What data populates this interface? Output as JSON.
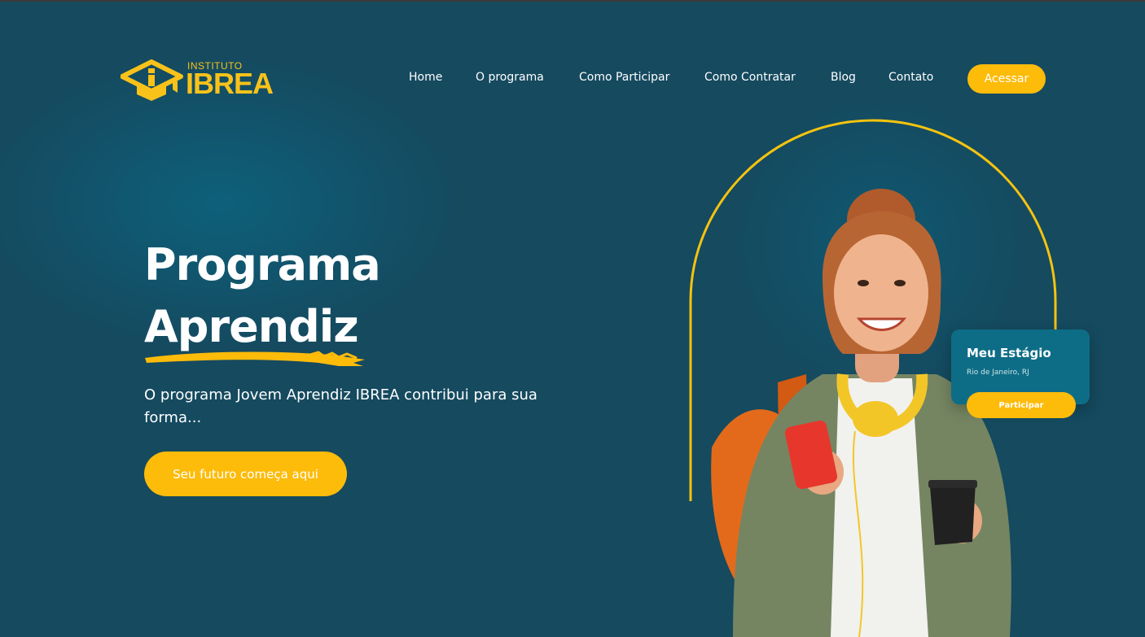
{
  "logo": {
    "small": "INSTITUTO",
    "big": "IBREA"
  },
  "nav": [
    "Home",
    "O programa",
    "Como Participar",
    "Como Contratar",
    "Blog",
    "Contato"
  ],
  "access_button": "Acessar",
  "hero": {
    "title_line1": "Programa",
    "title_line2": "Aprendiz",
    "description": "O programa Jovem Aprendiz IBREA contribui para sua forma...",
    "cta": "Seu futuro começa aqui"
  },
  "card": {
    "title": "Meu Estágio",
    "location": "Rio de Janeiro, RJ",
    "button": "Participar"
  },
  "colors": {
    "background": "#154a5f",
    "accent": "#fdbb0a",
    "card": "#0e6d86"
  }
}
